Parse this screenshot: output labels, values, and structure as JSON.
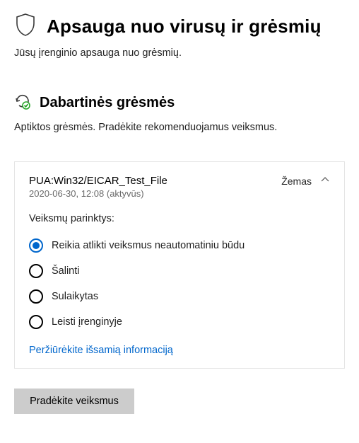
{
  "header": {
    "title": "Apsauga nuo virusų ir grėsmių",
    "subtitle": "Jūsų įrenginio apsauga nuo grėsmių."
  },
  "section": {
    "title": "Dabartinės grėsmės",
    "subtitle": "Aptiktos grėsmės. Pradėkite rekomenduojamus veiksmus."
  },
  "threat": {
    "name": "PUA:Win32/EICAR_Test_File",
    "timestamp": "2020-06-30, 12:08 (aktyvūs)",
    "severity_label": "Žemas",
    "options_title": "Veiksmų parinktys:",
    "options": [
      {
        "label": "Reikia atlikti veiksmus neautomatiniu būdu",
        "selected": true
      },
      {
        "label": "Šalinti",
        "selected": false
      },
      {
        "label": "Sulaikytas",
        "selected": false
      },
      {
        "label": "Leisti įrenginyje",
        "selected": false
      }
    ],
    "details_link": "Peržiūrėkite išsamią informaciją"
  },
  "actions": {
    "start_button": "Pradėkite veiksmus"
  },
  "colors": {
    "accent": "#0066cc",
    "button_bg": "#cccccc"
  }
}
